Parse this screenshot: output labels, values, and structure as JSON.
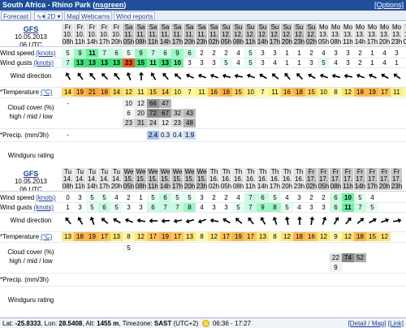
{
  "title": {
    "location": "South Africa - Rhino Park",
    "spot_name": "nsgreen",
    "options": "[Options]"
  },
  "nav": [
    {
      "label": "Forecast",
      "name": "nav-forecast"
    },
    {
      "label": "∿▾",
      "name": "nav-graph-menu"
    },
    {
      "label": "2D ▾",
      "name": "nav-2d-menu"
    },
    {
      "label": "Map",
      "name": "nav-map"
    },
    {
      "label": "Webcams",
      "name": "nav-webcams"
    },
    {
      "label": "Wind reports",
      "name": "nav-wind-reports"
    }
  ],
  "labels": {
    "wind_speed": "Wind speed",
    "wind_gusts": "Wind gusts",
    "knots": "(knots)",
    "wind_direction": "Wind direction",
    "temperature": "*Temperature",
    "celsius": "(°C)",
    "cloud": "Cloud cover (%)",
    "cloud2": "high / mid / low",
    "precip": "*Precip. (mm/3h)",
    "rating": "Windguru rating"
  },
  "forecasts": [
    {
      "model": "GFS",
      "date": "10.05.2013",
      "run": "06 UTC",
      "days": [
        "Fr",
        "Fr",
        "Fr",
        "Fr",
        "Fr",
        "Sa",
        "Sa",
        "Sa",
        "Sa",
        "Sa",
        "Sa",
        "Sa",
        "Sa",
        "Su",
        "Su",
        "Su",
        "Su",
        "Su",
        "Su",
        "Su",
        "Su",
        "Mo",
        "Mo",
        "Mo",
        "Mo",
        "Mo",
        "Mo",
        "Mo",
        "Tu"
      ],
      "dates": [
        "10.",
        "10.",
        "10.",
        "10.",
        "10.",
        "11.",
        "11.",
        "11.",
        "11.",
        "11.",
        "11.",
        "11.",
        "11.",
        "12.",
        "12.",
        "12.",
        "12.",
        "12.",
        "12.",
        "12.",
        "12.",
        "13.",
        "13.",
        "13.",
        "13.",
        "13.",
        "13.",
        "13.",
        "14."
      ],
      "hours": [
        "08h",
        "11h",
        "14h",
        "17h",
        "20h",
        "05h",
        "08h",
        "11h",
        "14h",
        "17h",
        "20h",
        "23h",
        "02h",
        "05h",
        "08h",
        "11h",
        "14h",
        "17h",
        "20h",
        "23h",
        "02h",
        "05h",
        "08h",
        "11h",
        "14h",
        "17h",
        "20h",
        "23h",
        "02h"
      ],
      "speed": [
        "5",
        "9",
        "11",
        "7",
        "6",
        "5",
        "9",
        "7",
        "6",
        "9",
        "6",
        "2",
        "2",
        "2",
        "4",
        "5",
        "3",
        "3",
        "1",
        "1",
        "2",
        "4",
        "3",
        "3",
        "2",
        "1",
        "4",
        "3",
        "1"
      ],
      "gusts": [
        "7",
        "13",
        "13",
        "13",
        "13",
        "23",
        "15",
        "11",
        "13",
        "10",
        "3",
        "3",
        "3",
        "5",
        "4",
        "5",
        "3",
        "4",
        "1",
        "1",
        "3",
        "5",
        "4",
        "3",
        "2",
        "1",
        "4",
        "1",
        "1"
      ],
      "dir": [
        150,
        145,
        140,
        135,
        140,
        160,
        180,
        150,
        140,
        130,
        115,
        110,
        110,
        105,
        100,
        110,
        120,
        130,
        140,
        135,
        120,
        110,
        105,
        100,
        110,
        115,
        120,
        125,
        130
      ],
      "temp": [
        "14",
        "19",
        "21",
        "18",
        "14",
        "12",
        "11",
        "15",
        "14",
        "10",
        "7",
        "11",
        "16",
        "18",
        "15",
        "10",
        "7",
        "11",
        "16",
        "18",
        "15",
        "10",
        "8",
        "12",
        "18",
        "19",
        "17",
        "11",
        "8"
      ],
      "cloud_high": [
        "-",
        "",
        "",
        "",
        "",
        "10",
        "12",
        "66",
        "47",
        "",
        "",
        "",
        "",
        "",
        "",
        "",
        "",
        "",
        "",
        "",
        "",
        "",
        "",
        "",
        "",
        "",
        "",
        "",
        ""
      ],
      "cloud_mid": [
        "",
        "",
        "",
        "",
        "",
        "6",
        "20",
        "72",
        "67",
        "32",
        "43",
        "",
        "",
        "",
        "",
        "",
        "",
        "",
        "",
        "",
        "",
        "",
        "",
        "",
        "",
        "",
        "",
        "",
        ""
      ],
      "cloud_low": [
        "",
        "",
        "",
        "",
        "",
        "23",
        "31",
        "24",
        "12",
        "23",
        "48",
        "",
        "",
        "",
        "",
        "",
        "",
        "",
        "",
        "",
        "",
        "",
        "",
        "",
        "",
        "",
        "",
        "",
        ""
      ],
      "precip": [
        "-",
        "",
        "",
        "",
        "",
        "",
        "",
        "2.4",
        "0.3",
        "0.4",
        "1.9",
        "",
        "",
        "",
        "",
        "",
        "",
        "",
        "",
        "",
        "",
        "",
        "",
        "",
        "",
        "",
        "",
        "",
        ""
      ]
    },
    {
      "model": "GFS",
      "date": "10.05.2013",
      "run": "06 UTC",
      "days": [
        "Tu",
        "Tu",
        "Tu",
        "Tu",
        "Tu",
        "We",
        "We",
        "We",
        "We",
        "We",
        "We",
        "We",
        "Th",
        "Th",
        "Th",
        "Th",
        "Th",
        "Th",
        "Th",
        "Th",
        "Fr",
        "Fr",
        "Fr",
        "Fr",
        "Fr",
        "Fr",
        "Fr",
        "Fr"
      ],
      "dates": [
        "14.",
        "14.",
        "14.",
        "14.",
        "14.",
        "15.",
        "15.",
        "15.",
        "15.",
        "15.",
        "15.",
        "15.",
        "16.",
        "16.",
        "16.",
        "16.",
        "16.",
        "16.",
        "16.",
        "16.",
        "17.",
        "17.",
        "17.",
        "17.",
        "17.",
        "17.",
        "17.",
        "17."
      ],
      "hours": [
        "08h",
        "11h",
        "14h",
        "17h",
        "20h",
        "05h",
        "08h",
        "11h",
        "14h",
        "17h",
        "20h",
        "23h",
        "02h",
        "05h",
        "08h",
        "11h",
        "14h",
        "17h",
        "20h",
        "23h",
        "02h",
        "05h",
        "08h",
        "11h",
        "14h",
        "17h",
        "20h",
        "23h"
      ],
      "speed": [
        "0",
        "3",
        "5",
        "5",
        "4",
        "2",
        "1",
        "5",
        "6",
        "5",
        "5",
        "3",
        "2",
        "2",
        "4",
        "7",
        "6",
        "5",
        "4",
        "3",
        "2",
        "2",
        "6",
        "10",
        "5",
        "4",
        "",
        ""
      ],
      "gusts": [
        "1",
        "3",
        "5",
        "6",
        "5",
        "3",
        "3",
        "6",
        "7",
        "7",
        "8",
        "4",
        "3",
        "3",
        "5",
        "7",
        "9",
        "8",
        "5",
        "4",
        "3",
        "3",
        "6",
        "11",
        "7",
        "5",
        "",
        ""
      ],
      "dir": [
        140,
        150,
        160,
        130,
        120,
        110,
        100,
        90,
        85,
        80,
        75,
        70,
        100,
        120,
        130,
        140,
        150,
        160,
        170,
        180,
        190,
        200,
        210,
        220,
        230,
        240,
        250,
        260
      ],
      "temp": [
        "13",
        "18",
        "19",
        "17",
        "13",
        "8",
        "12",
        "17",
        "19",
        "17",
        "13",
        "8",
        "12",
        "17",
        "19",
        "17",
        "13",
        "8",
        "12",
        "18",
        "16",
        "12",
        "9",
        "12",
        "18",
        "15",
        "12",
        ""
      ],
      "cloud_high": [
        "",
        "",
        "",
        "",
        "",
        "5",
        "",
        "",
        "",
        "",
        "",
        "",
        "",
        "",
        "",
        "",
        "",
        "",
        "",
        "",
        "",
        "",
        "",
        "",
        "",
        "",
        "",
        ""
      ],
      "cloud_mid": [
        "",
        "",
        "",
        "",
        "",
        "",
        "",
        "",
        "",
        "",
        "",
        "",
        "",
        "",
        "",
        "",
        "",
        "",
        "",
        "",
        "",
        "",
        "22",
        "74",
        "52",
        "",
        "",
        ""
      ],
      "cloud_low": [
        "",
        "",
        "",
        "",
        "",
        "",
        "",
        "",
        "",
        "",
        "",
        "",
        "",
        "",
        "",
        "",
        "",
        "",
        "",
        "",
        "",
        "",
        "9",
        "",
        "",
        "",
        "",
        ""
      ],
      "precip": [
        "",
        "",
        "",
        "",
        "",
        "",
        "",
        "",
        "",
        "",
        "",
        "",
        "",
        "",
        "",
        "",
        "",
        "",
        "",
        "",
        "",
        "",
        "",
        "",
        "",
        "",
        "",
        ""
      ]
    }
  ],
  "footer": {
    "lat_label": "Lat:",
    "lat": "-25.8333",
    "lon_label": ", Lon:",
    "lon": "28.5408",
    "alt_label": ", Alt:",
    "alt": "1455 m",
    "tz_label": ", Timezone:",
    "tz": "SAST",
    "tz_offset": "(UTC+2)",
    "sun": "06:36 - 17:27",
    "detail": "[Detail / Map]",
    "link": "[Link]"
  },
  "colors": {
    "header_bg": "#1f4f9b",
    "weekend": "#c8c8c8",
    "weekday": "#e4e4e4"
  }
}
